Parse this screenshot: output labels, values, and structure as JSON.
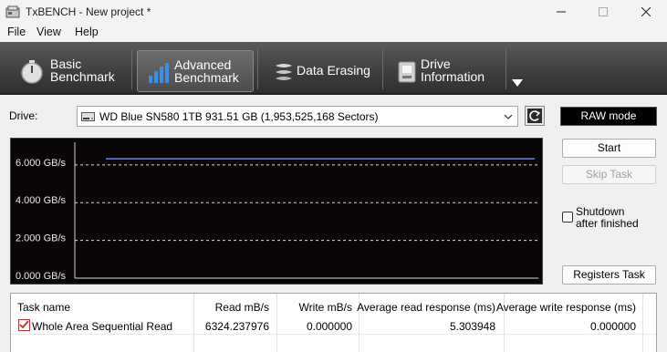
{
  "window": {
    "title": "TxBENCH - New project *"
  },
  "menu": [
    "File",
    "View",
    "Help"
  ],
  "ribbon": {
    "tabs": [
      {
        "label": "Basic\nBenchmark",
        "icon": "gauge-icon"
      },
      {
        "label": "Advanced\nBenchmark",
        "icon": "bar-chart-icon",
        "active": true
      },
      {
        "label": "Data Erasing",
        "icon": "eraser-icon"
      },
      {
        "label": "Drive\nInformation",
        "icon": "drive-info-icon"
      }
    ]
  },
  "drive": {
    "label": "Drive:",
    "selected": "WD Blue SN580 1TB  931.51 GB (1,953,525,168 Sectors)"
  },
  "raw_mode_label": "RAW mode",
  "buttons": {
    "start": "Start",
    "skip": "Skip Task",
    "registers": "Registers Task"
  },
  "shutdown_label": "Shutdown\nafter finished",
  "colors": {
    "chart_background": "#0b0606",
    "series_line": "#6f7fe0",
    "grid": "#d8d8d8"
  },
  "chart_data": {
    "type": "line",
    "title": "",
    "xlabel": "",
    "ylabel": "",
    "ylim": [
      0,
      7.2
    ],
    "yticks": [
      "0.000 GB/s",
      "2.000 GB/s",
      "4.000 GB/s",
      "6.000 GB/s"
    ],
    "ytick_values": [
      0,
      2,
      4,
      6
    ],
    "grid": true,
    "series": [
      {
        "x": [
          0,
          100
        ],
        "values": [
          6.324,
          6.324
        ]
      }
    ]
  },
  "table": {
    "headers": [
      "Task name",
      "Read mB/s",
      "Write mB/s",
      "Average read response (ms)",
      "Average write response (ms)"
    ],
    "rows": [
      [
        "Whole Area Sequential Read",
        "6324.237976",
        "0.000000",
        "5.303948",
        "0.000000"
      ]
    ]
  }
}
